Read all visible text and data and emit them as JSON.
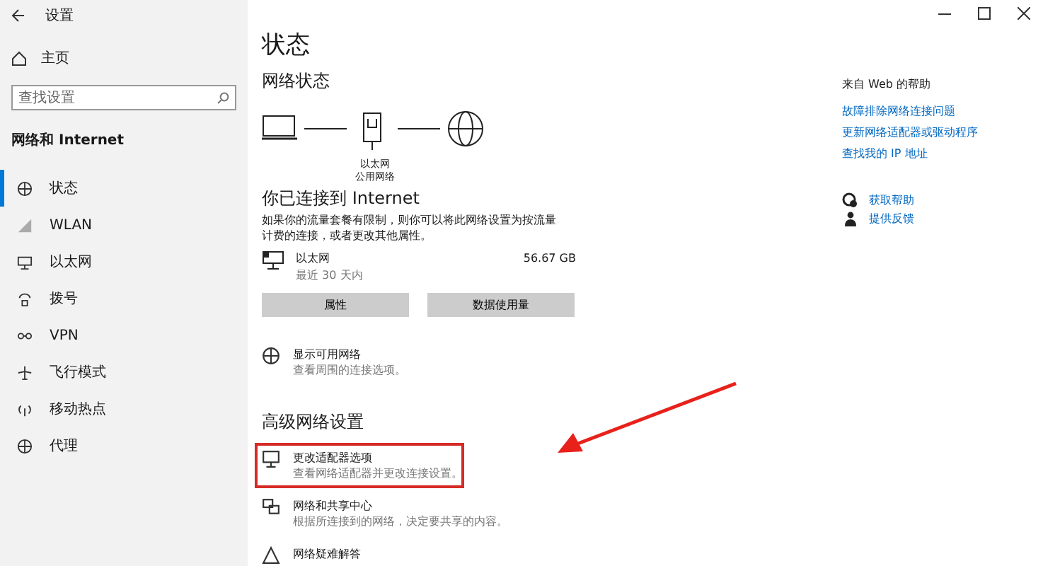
{
  "window": {
    "title": "设置"
  },
  "sidebar": {
    "home": "主页",
    "search": {
      "placeholder": "查找设置"
    },
    "section": "网络和 Internet",
    "items": [
      {
        "label": "状态",
        "selected": true
      },
      {
        "label": "WLAN",
        "selected": false
      },
      {
        "label": "以太网",
        "selected": false
      },
      {
        "label": "拨号",
        "selected": false
      },
      {
        "label": "VPN",
        "selected": false
      },
      {
        "label": "飞行模式",
        "selected": false
      },
      {
        "label": "移动热点",
        "selected": false
      },
      {
        "label": "代理",
        "selected": false
      }
    ]
  },
  "main": {
    "title": "状态",
    "network_status": "网络状态",
    "diagram_label": [
      "以太网",
      "公用网络"
    ],
    "connected_title": "你已连接到 Internet",
    "connected_desc": "如果你的流量套餐有限制，则你可以将此网络设置为按流量计费的连接，或者更改其他属性。",
    "connection": {
      "name": "以太网",
      "period": "最近 30 天内",
      "usage": "56.67 GB"
    },
    "buttons": [
      "属性",
      "数据使用量"
    ],
    "show_networks": {
      "title": "显示可用网络",
      "desc": "查看周围的连接选项。"
    },
    "advanced_title": "高级网络设置",
    "advanced_items": [
      {
        "title": "更改适配器选项",
        "desc": "查看网络适配器并更改连接设置。",
        "highlighted": true
      },
      {
        "title": "网络和共享中心",
        "desc": "根据所连接到的网络，决定要共享的内容。",
        "highlighted": false
      },
      {
        "title": "网络疑难解答",
        "highlighted": false
      }
    ]
  },
  "help": {
    "title": "来自 Web 的帮助",
    "links": [
      "故障排除网络连接问题",
      "更新网络适配器或驱动程序",
      "查找我的 IP 地址"
    ],
    "actions": [
      "获取帮助",
      "提供反馈"
    ]
  }
}
